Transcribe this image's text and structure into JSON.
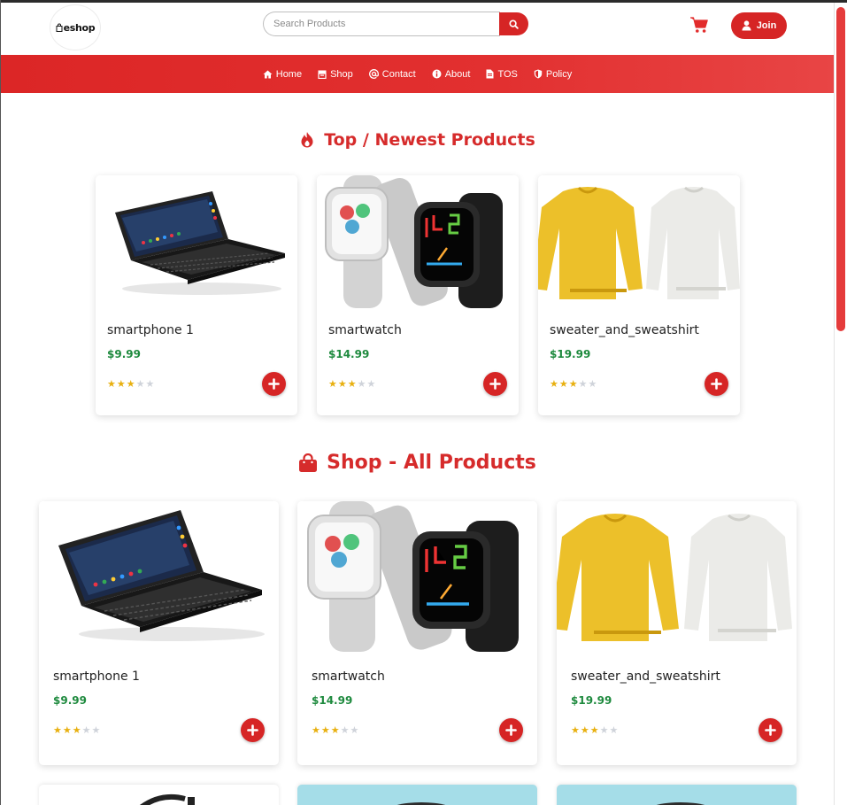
{
  "header": {
    "logo_text": "eshop",
    "search_placeholder": "Search Products",
    "join_label": "Join"
  },
  "nav": {
    "items": [
      {
        "label": "Home",
        "icon": "home-icon"
      },
      {
        "label": "Shop",
        "icon": "shop-icon"
      },
      {
        "label": "Contact",
        "icon": "at-icon"
      },
      {
        "label": "About",
        "icon": "info-icon"
      },
      {
        "label": "TOS",
        "icon": "document-icon"
      },
      {
        "label": "Policy",
        "icon": "shield-icon"
      }
    ]
  },
  "sections": {
    "top": {
      "title": "Top / Newest Products",
      "icon": "fire-icon"
    },
    "shop": {
      "title": "Shop - All Products",
      "icon": "shopping-bag-icon"
    }
  },
  "top_products": [
    {
      "name": "smartphone 1",
      "price": "$9.99",
      "rating": 3,
      "image": "smartphone-image"
    },
    {
      "name": "smartwatch",
      "price": "$14.99",
      "rating": 3,
      "image": "smartwatch-image"
    },
    {
      "name": "sweater_and_sweatshirt",
      "price": "$19.99",
      "rating": 3,
      "image": "sweater-image"
    }
  ],
  "shop_products": [
    {
      "name": "smartphone 1",
      "price": "$9.99",
      "rating": 3,
      "image": "smartphone-image"
    },
    {
      "name": "smartwatch",
      "price": "$14.99",
      "rating": 3,
      "image": "smartwatch-image"
    },
    {
      "name": "sweater_and_sweatshirt",
      "price": "$19.99",
      "rating": 3,
      "image": "sweater-image"
    }
  ],
  "colors": {
    "brand_red": "#d62525",
    "price_green": "#1e8a3e",
    "star_gold": "#e8b010",
    "star_grey": "#cfd3da"
  }
}
